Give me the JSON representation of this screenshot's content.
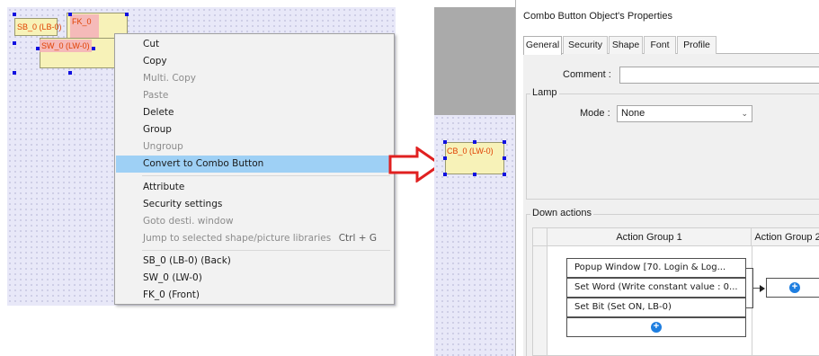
{
  "left_canvas": {
    "objects": [
      {
        "name": "sb",
        "label": "SB_0 (LB-0)"
      },
      {
        "name": "sw",
        "label": "SW_0 (LW-0)"
      },
      {
        "name": "fk",
        "label": "FK_0"
      }
    ]
  },
  "context_menu": {
    "items": [
      {
        "label": "Cut",
        "disabled": false
      },
      {
        "label": "Copy",
        "disabled": false
      },
      {
        "label": "Multi. Copy",
        "disabled": true
      },
      {
        "label": "Paste",
        "disabled": true
      },
      {
        "label": "Delete",
        "disabled": false
      },
      {
        "label": "Group",
        "disabled": false
      },
      {
        "label": "Ungroup",
        "disabled": true
      },
      {
        "label": "Convert to Combo Button",
        "disabled": false,
        "highlight": true
      },
      {
        "label": "Attribute",
        "disabled": false
      },
      {
        "label": "Security settings",
        "disabled": false
      },
      {
        "label": "Goto desti. window",
        "disabled": true
      },
      {
        "label": "Jump to selected shape/picture libraries",
        "disabled": true,
        "shortcut": "Ctrl + G"
      },
      {
        "label": "SB_0 (LB-0) (Back)",
        "disabled": false
      },
      {
        "label": "SW_0 (LW-0)",
        "disabled": false
      },
      {
        "label": "FK_0 (Front)",
        "disabled": false
      }
    ]
  },
  "right_canvas": {
    "object_label": "CB_0 (LW-0)"
  },
  "dialog": {
    "title": "Combo Button Object's Properties",
    "tabs": [
      "General",
      "Security",
      "Shape",
      "Font",
      "Profile"
    ],
    "active_tab": "General",
    "comment_label": "Comment :",
    "comment_value": "",
    "lamp_title": "Lamp",
    "mode_label": "Mode :",
    "mode_value": "None",
    "down_actions_title": "Down actions",
    "action_group_1": "Action Group 1",
    "action_group_2": "Action Group 2",
    "actions": [
      "Popup Window [70. Login & Log...",
      "Set Word (Write constant value : 0...",
      "Set Bit (Set ON, LB-0)"
    ]
  },
  "colors": {
    "canvas_bg": "#e8e8f8",
    "object_fill": "#f7f2b8",
    "menu_highlight": "#9ed0f5",
    "arrow_red": "#e02020",
    "handle_blue": "#1010e0",
    "plus_blue": "#1e7ee0"
  }
}
